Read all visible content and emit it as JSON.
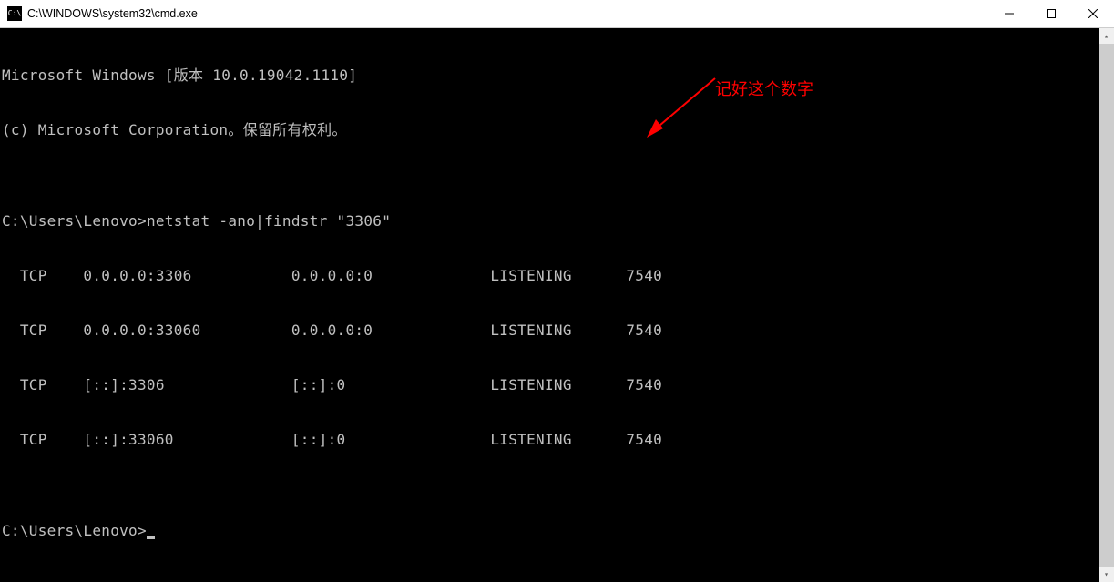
{
  "window": {
    "title": "C:\\WINDOWS\\system32\\cmd.exe"
  },
  "terminal": {
    "header1": "Microsoft Windows [版本 10.0.19042.1110]",
    "header2": "(c) Microsoft Corporation。保留所有权利。",
    "blank": "",
    "prompt1": "C:\\Users\\Lenovo>",
    "command1": "netstat -ano|findstr \"3306\"",
    "rows": [
      {
        "proto": "TCP",
        "local": "0.0.0.0:3306",
        "foreign": "0.0.0.0:0",
        "state": "LISTENING",
        "pid": "7540"
      },
      {
        "proto": "TCP",
        "local": "0.0.0.0:33060",
        "foreign": "0.0.0.0:0",
        "state": "LISTENING",
        "pid": "7540"
      },
      {
        "proto": "TCP",
        "local": "[::]:3306",
        "foreign": "[::]:0",
        "state": "LISTENING",
        "pid": "7540"
      },
      {
        "proto": "TCP",
        "local": "[::]:33060",
        "foreign": "[::]:0",
        "state": "LISTENING",
        "pid": "7540"
      }
    ],
    "prompt2": "C:\\Users\\Lenovo>"
  },
  "annotation": {
    "text": "记好这个数字"
  }
}
